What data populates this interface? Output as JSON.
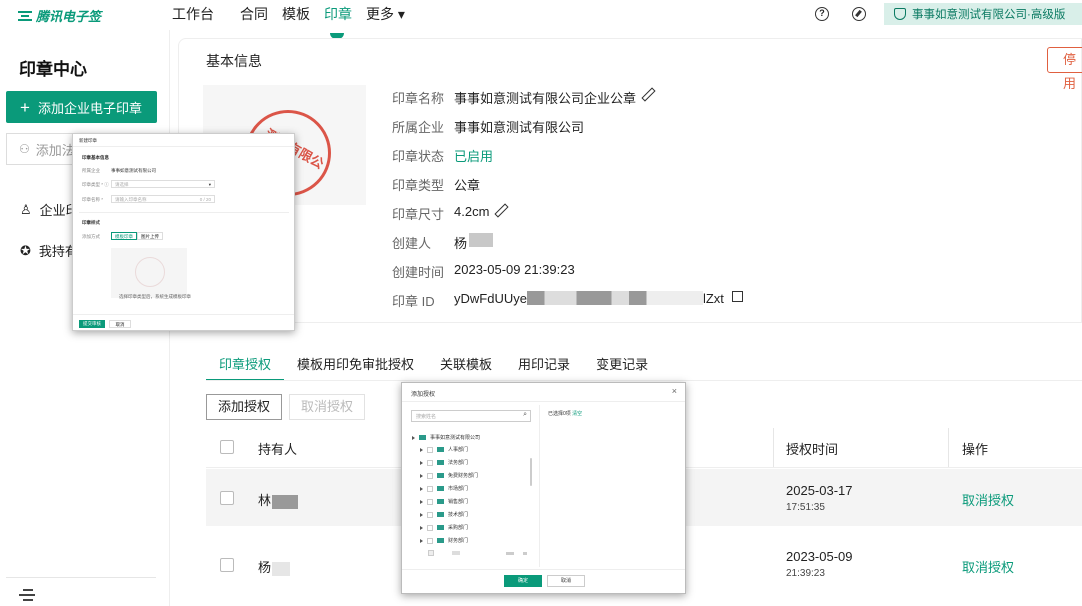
{
  "app": {
    "logo": "腾讯电子签"
  },
  "nav": {
    "items": [
      "工作台",
      "合同",
      "模板",
      "印章",
      "更多 ▾"
    ],
    "active_index": 3
  },
  "header": {
    "company": "事事如意测试有限公司·高级版"
  },
  "sidebar": {
    "title": "印章中心",
    "add_button": "添加企业电子印章",
    "search_placeholder": "添加法",
    "items": [
      "企业印",
      "我持有"
    ]
  },
  "seal_detail": {
    "section_title": "基本信息",
    "disable_button": "停用",
    "seal_text": "测试有限公司",
    "fields": [
      {
        "label": "印章名称",
        "value": "事事如意测试有限公司企业公章"
      },
      {
        "label": "所属企业",
        "value": "事事如意测试有限公司"
      },
      {
        "label": "印章状态",
        "value": "已启用"
      },
      {
        "label": "印章类型",
        "value": "公章"
      },
      {
        "label": "印章尺寸",
        "value": "4.2cm"
      },
      {
        "label": "创建人",
        "value": "杨"
      },
      {
        "label": "创建时间",
        "value": "2023-05-09 21:39:23"
      },
      {
        "label": "印章 ID",
        "value_prefix": "yDwFdUUye",
        "value_suffix": "lZxt"
      }
    ]
  },
  "tabs": [
    "印章授权",
    "模板用印免审批授权",
    "关联模板",
    "用印记录",
    "变更记录"
  ],
  "toolbar": {
    "add": "添加授权",
    "cancel": "取消授权"
  },
  "table": {
    "headers": [
      "持有人",
      "授权时间",
      "操作"
    ],
    "rows": [
      {
        "holder": "林",
        "date": "2025-03-17",
        "time": "17:51:35",
        "action": "取消授权"
      },
      {
        "holder": "杨",
        "date": "2023-05-09",
        "time": "21:39:23",
        "action": "取消授权"
      }
    ]
  },
  "form_overlay": {
    "title": "新建印章",
    "section1": "印章基本信息",
    "company_label": "所属企业",
    "company_value": "事事如意测试有限公司",
    "type_label": "印章类型 * ⓘ",
    "type_placeholder": "请选择",
    "name_label": "印章名称 *",
    "name_placeholder": "请输入印章名称",
    "name_counter": "0 / 20",
    "section2": "印章样式",
    "method_label": "添加方式",
    "method_a": "模板印章",
    "method_b": "图片上传",
    "hint": "选择印章类型后，系统生成模板印章",
    "submit": "提交审核",
    "cancel": "取消"
  },
  "auth_dialog": {
    "title": "添加授权",
    "close": "×",
    "search_placeholder": "搜索姓名",
    "selected": "已选择0项",
    "clear": "清空",
    "root": "事事如意测试有限公司",
    "departments": [
      "人事部门",
      "法务部门",
      "免费财务部门",
      "市场部门",
      "销售部门",
      "技术部门",
      "采购部门",
      "财务部门"
    ],
    "ok": "确定",
    "cancel": "取消"
  },
  "colors": {
    "accent": "#0a9a7a",
    "danger": "#e06040",
    "seal_red": "#d73a2a"
  }
}
